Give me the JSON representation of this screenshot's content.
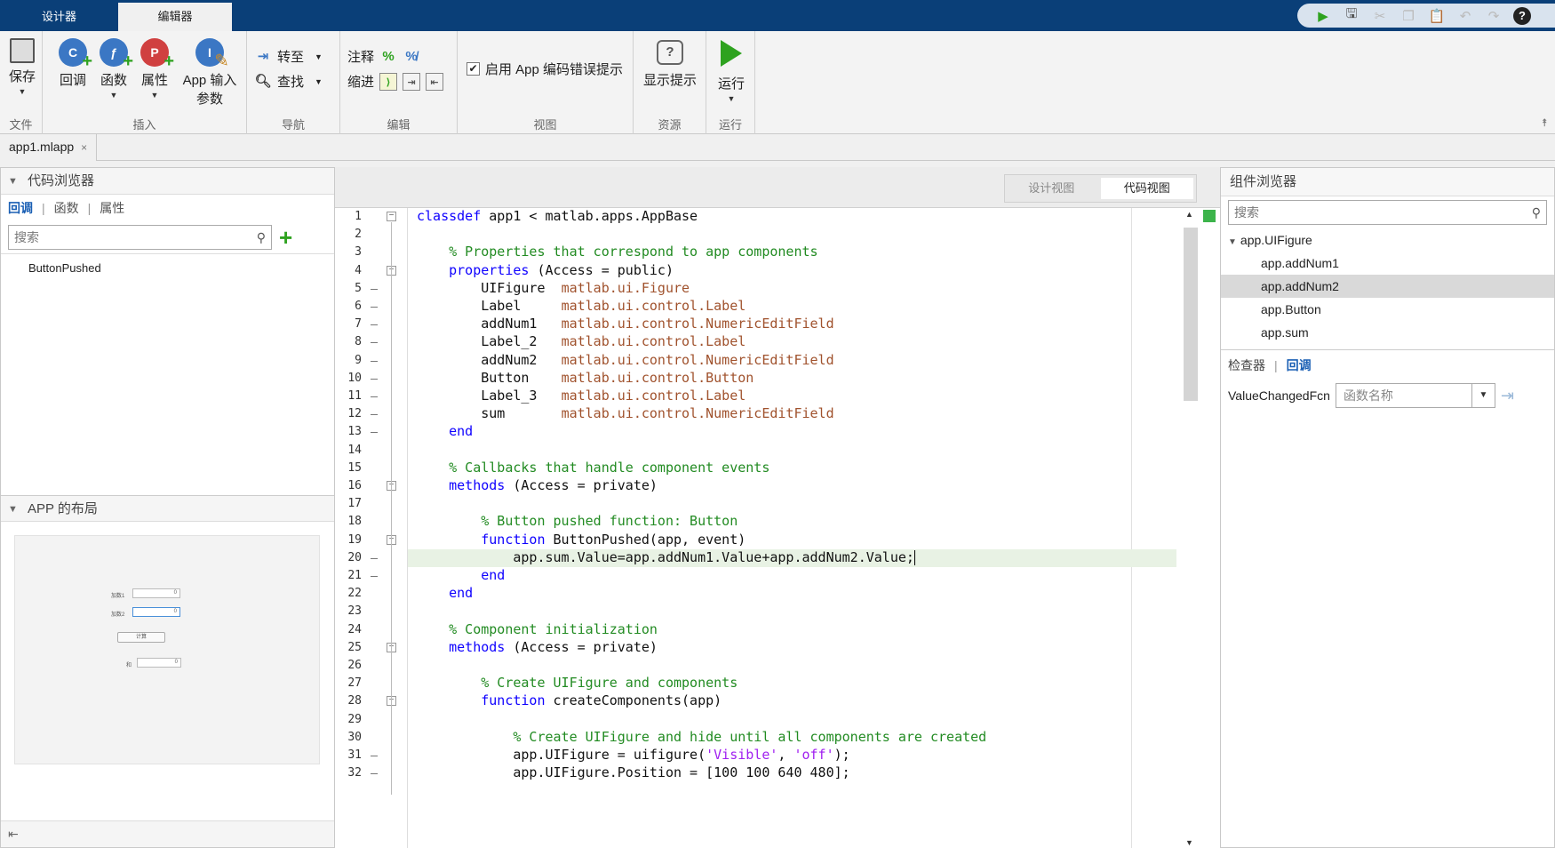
{
  "tabs": {
    "designer": "设计器",
    "editor": "编辑器"
  },
  "quick_access": [
    "run-icon",
    "save-icon",
    "cut-icon",
    "copy-icon",
    "paste-icon",
    "undo-icon",
    "redo-icon",
    "help-icon"
  ],
  "ribbon": {
    "file": {
      "label": "文件",
      "save": "保存"
    },
    "insert": {
      "label": "插入",
      "callback": "回调",
      "function": "函数",
      "property": "属性",
      "app_input_line1": "App 输入",
      "app_input_line2": "参数",
      "callback_glyph": "C",
      "function_glyph": "ƒ",
      "property_glyph": "P",
      "app_input_glyph": "I"
    },
    "navigate": {
      "label": "导航",
      "goto": "转至",
      "find": "查找"
    },
    "edit": {
      "label": "编辑",
      "comment": "注释",
      "indent": "缩进"
    },
    "view": {
      "label": "视图",
      "checkbox_label": "启用 App 编码错误提示",
      "checked": true
    },
    "resources": {
      "label": "资源",
      "show_tips": "显示提示"
    },
    "run": {
      "label": "运行",
      "run": "运行"
    }
  },
  "file_tab": {
    "name": "app1.mlapp",
    "close": "×"
  },
  "code_browser": {
    "title": "代码浏览器",
    "tabs": [
      "回调",
      "函数",
      "属性"
    ],
    "search_placeholder": "搜索",
    "items": [
      "ButtonPushed"
    ]
  },
  "app_layout": {
    "title": "APP 的布局",
    "preview": {
      "label1": "加数1",
      "label2": "加数2",
      "button": "计算",
      "label3": "和",
      "value": "0"
    }
  },
  "view_switch": {
    "design": "设计视图",
    "code": "代码视图"
  },
  "code_lines": [
    "classdef app1 < matlab.apps.AppBase",
    "",
    "    % Properties that correspond to app components",
    "    properties (Access = public)",
    "        UIFigure  matlab.ui.Figure",
    "        Label     matlab.ui.control.Label",
    "        addNum1   matlab.ui.control.NumericEditField",
    "        Label_2   matlab.ui.control.Label",
    "        addNum2   matlab.ui.control.NumericEditField",
    "        Button    matlab.ui.control.Button",
    "        Label_3   matlab.ui.control.Label",
    "        sum       matlab.ui.control.NumericEditField",
    "    end",
    "",
    "    % Callbacks that handle component events",
    "    methods (Access = private)",
    "",
    "        % Button pushed function: Button",
    "        function ButtonPushed(app, event)",
    "            app.sum.Value=app.addNum1.Value+app.addNum2.Value;",
    "        end",
    "    end",
    "",
    "    % Component initialization",
    "    methods (Access = private)",
    "",
    "        % Create UIFigure and components",
    "        function createComponents(app)",
    "",
    "            % Create UIFigure and hide until all components are created",
    "            app.UIFigure = uifigure('Visible', 'off');",
    "            app.UIFigure.Position = [100 100 640 480];"
  ],
  "current_line": 20,
  "component_browser": {
    "title": "组件浏览器",
    "search_placeholder": "搜索",
    "root": "app.UIFigure",
    "children": [
      "app.addNum1",
      "app.addNum2",
      "app.Button",
      "app.sum"
    ],
    "selected": "app.addNum2"
  },
  "inspector": {
    "tabs": [
      "检查器",
      "回调"
    ],
    "callback_name": "ValueChangedFcn",
    "function_placeholder": "函数名称"
  },
  "colors": {
    "titlebar": "#0a3f78",
    "keyword": "#0e00ff",
    "comment": "#228b22",
    "type": "#a0522d",
    "string": "#a020f0",
    "current_line": "#e8f2e4"
  }
}
